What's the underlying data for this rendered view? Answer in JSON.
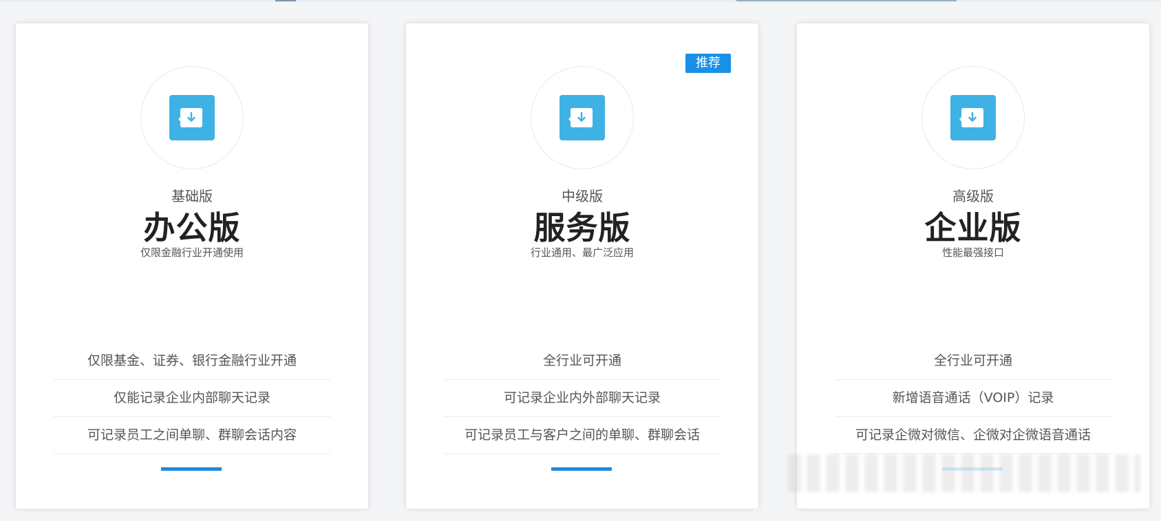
{
  "plans": [
    {
      "tier": "基础版",
      "name": "办公版",
      "description": "仅限金融行业开通使用",
      "features": [
        "仅限基金、证券、银行金融行业开通",
        "仅能记录企业内部聊天记录",
        "可记录员工之间单聊、群聊会话内容"
      ]
    },
    {
      "tier": "中级版",
      "name": "服务版",
      "description": "行业通用、最广泛应用",
      "badge": "推荐",
      "features": [
        "全行业可开通",
        "可记录企业内外部聊天记录",
        "可记录员工与客户之间的单聊、群聊会话"
      ]
    },
    {
      "tier": "高级版",
      "name": "企业版",
      "description": "性能最强接口",
      "features": [
        "全行业可开通",
        "新增语音通话（VOIP）记录",
        "可记录企微对微信、企微对企微语音通话"
      ]
    }
  ],
  "colors": {
    "accent": "#1d89de",
    "badge": "#198fe6",
    "icon_tile": "#3fb2e5",
    "text": "#555555",
    "title": "#222222"
  },
  "icons": {
    "plan": "download-box-icon"
  }
}
